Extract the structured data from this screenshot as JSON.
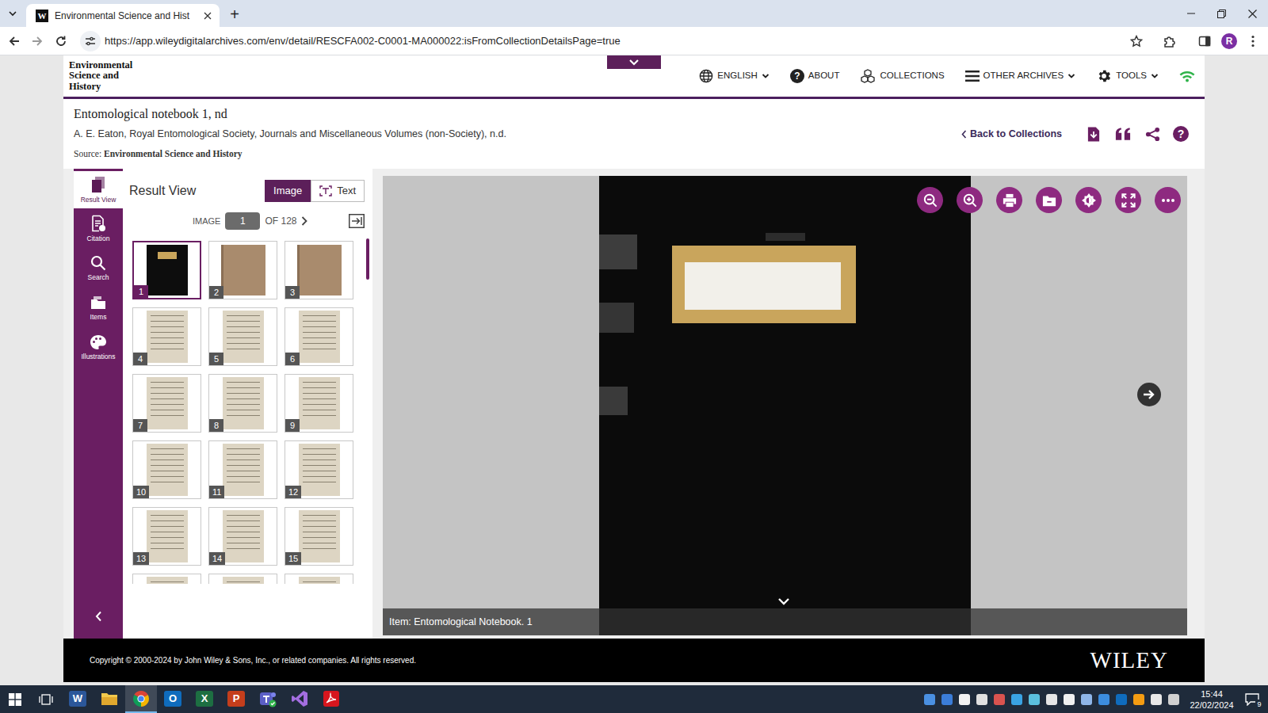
{
  "browser": {
    "tabs": [
      {
        "title": "Environmental Science and Hist",
        "favicon": "W",
        "selected": true
      }
    ],
    "new_tab": "+",
    "url": "https://app.wileydigitalarchives.com/env/detail/RESCFA002-C0001-MA000022:isFromCollectionDetailsPage=true",
    "bookmarked": false,
    "profile": "R"
  },
  "site": {
    "logo": [
      "Environmental",
      "Science and",
      "History"
    ],
    "nav": [
      {
        "label": "ENGLISH",
        "kind": "language",
        "dropdown": true
      },
      {
        "label": "ABOUT",
        "kind": "about",
        "glyph": "?",
        "dropdown": false
      },
      {
        "label": "COLLECTIONS",
        "kind": "collections",
        "dropdown": false
      },
      {
        "label": "OTHER ARCHIVES",
        "kind": "archives",
        "dropdown": true
      },
      {
        "label": "TOOLS",
        "kind": "tools",
        "dropdown": true
      }
    ],
    "online": true
  },
  "document": {
    "title": "Entomological notebook 1, nd",
    "author": "A. E. Eaton, Royal Entomological Society, Journals and Miscellaneous Volumes (non-Society), n.d.",
    "source_label": "Source:",
    "source": "Environmental Science and History",
    "back_link": "Back to Collections",
    "help": "?"
  },
  "sidebar": {
    "items": [
      {
        "label": "Result View",
        "kind": "result-view",
        "selected": true
      },
      {
        "label": "Citation",
        "kind": "citation",
        "selected": false
      },
      {
        "label": "Search",
        "kind": "search",
        "selected": false
      },
      {
        "label": "Items",
        "kind": "items",
        "selected": false
      },
      {
        "label": "Illustrations",
        "kind": "illustrations",
        "selected": false
      }
    ]
  },
  "result_view": {
    "title": "Result View",
    "modes": [
      {
        "label": "Image",
        "selected": true
      },
      {
        "label": "Text",
        "selected": false
      }
    ],
    "image_label": "IMAGE",
    "current_image": "1",
    "total": "OF 128",
    "thumbnails": [
      {
        "number": "1",
        "kind": "cover",
        "selected": true
      },
      {
        "number": "2",
        "kind": "board",
        "selected": false
      },
      {
        "number": "3",
        "kind": "board",
        "selected": false
      },
      {
        "number": "4",
        "kind": "page",
        "selected": false
      },
      {
        "number": "5",
        "kind": "page",
        "selected": false
      },
      {
        "number": "6",
        "kind": "page",
        "selected": false
      },
      {
        "number": "7",
        "kind": "page",
        "selected": false
      },
      {
        "number": "8",
        "kind": "page",
        "selected": false
      },
      {
        "number": "9",
        "kind": "page",
        "selected": false
      },
      {
        "number": "10",
        "kind": "page",
        "selected": false
      },
      {
        "number": "11",
        "kind": "page",
        "selected": false
      },
      {
        "number": "12",
        "kind": "page",
        "selected": false
      },
      {
        "number": "13",
        "kind": "page",
        "selected": false
      },
      {
        "number": "14",
        "kind": "page",
        "selected": false
      },
      {
        "number": "15",
        "kind": "page",
        "selected": false
      },
      {
        "kind": "page",
        "selected": false
      },
      {
        "kind": "page",
        "selected": false
      },
      {
        "kind": "page",
        "selected": false
      }
    ]
  },
  "viewer": {
    "caption": "Item: Entomological Notebook. 1"
  },
  "footer": {
    "copyright": "Copyright © 2000-2024 by John Wiley & Sons, Inc., or related companies. All rights reserved.",
    "brand": "WILEY"
  },
  "taskbar": {
    "apps": [
      {
        "kind": "word",
        "glyph": "W",
        "color": "#2b579a",
        "active": false
      },
      {
        "kind": "explorer",
        "color": "#f2c94c",
        "active": false
      },
      {
        "kind": "chrome",
        "color": "#4285f4",
        "active": true
      },
      {
        "kind": "outlook",
        "glyph": "O",
        "color": "#0f6cbd",
        "active": false
      },
      {
        "kind": "excel",
        "glyph": "X",
        "color": "#1d6f42",
        "active": false
      },
      {
        "kind": "powerpoint",
        "glyph": "P",
        "color": "#c43e1c",
        "active": false
      },
      {
        "kind": "teams",
        "color": "#5b5fc7",
        "active": false
      },
      {
        "kind": "visual-studio",
        "color": "#a36ee0",
        "active": false
      },
      {
        "kind": "acrobat",
        "color": "#d7161e",
        "active": false
      }
    ],
    "tray": [
      {
        "color": "#4a90e2"
      },
      {
        "color": "#3b7dd8"
      },
      {
        "color": "#f2f2f2"
      },
      {
        "color": "#e0e0e0"
      },
      {
        "color": "#d9534f"
      },
      {
        "color": "#3aa3e3"
      },
      {
        "color": "#5bc0de"
      },
      {
        "color": "#e6e6e6"
      },
      {
        "color": "#f0f0f0"
      },
      {
        "color": "#8fb6e8"
      },
      {
        "color": "#3c8dde"
      },
      {
        "color": "#0f6cbd"
      },
      {
        "color": "#f39c12"
      },
      {
        "color": "#e8e8e8"
      },
      {
        "color": "#d0d0d0"
      }
    ],
    "time": "15:44",
    "date": "22/02/2024",
    "notifications": "9"
  }
}
